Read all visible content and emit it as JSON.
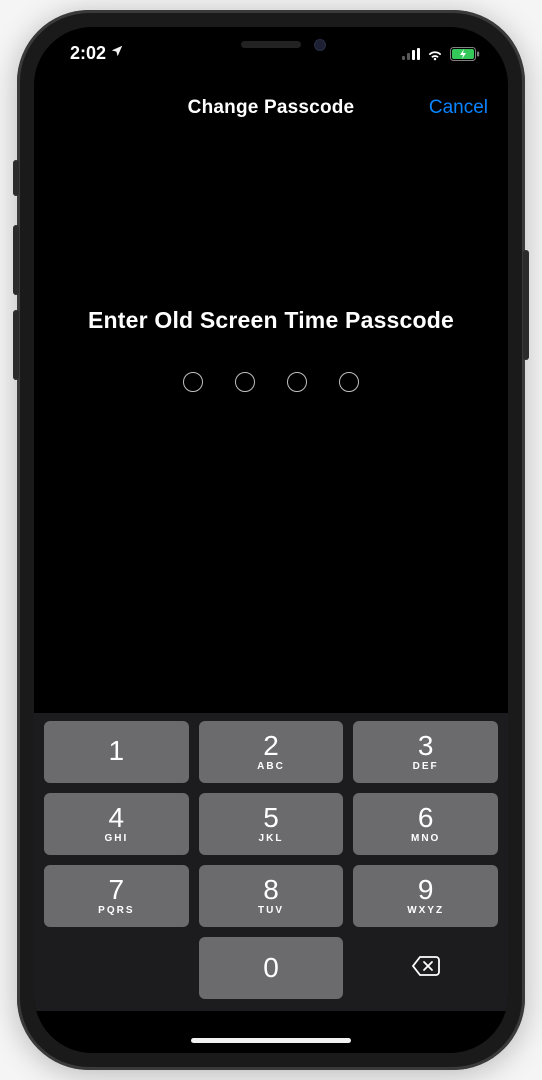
{
  "status": {
    "time": "2:02",
    "locationIcon": "location-arrow-icon"
  },
  "nav": {
    "title": "Change Passcode",
    "cancel": "Cancel"
  },
  "prompt": {
    "text": "Enter Old Screen Time Passcode",
    "passcodeLength": 4
  },
  "keypad": {
    "keys": [
      {
        "digit": "1",
        "letters": ""
      },
      {
        "digit": "2",
        "letters": "ABC"
      },
      {
        "digit": "3",
        "letters": "DEF"
      },
      {
        "digit": "4",
        "letters": "GHI"
      },
      {
        "digit": "5",
        "letters": "JKL"
      },
      {
        "digit": "6",
        "letters": "MNO"
      },
      {
        "digit": "7",
        "letters": "PQRS"
      },
      {
        "digit": "8",
        "letters": "TUV"
      },
      {
        "digit": "9",
        "letters": "WXYZ"
      },
      {
        "digit": "0",
        "letters": ""
      }
    ],
    "deleteIcon": "delete-icon"
  },
  "colors": {
    "accent": "#0a84ff",
    "keyBg": "#6b6b6d",
    "keypadBg": "#1c1c1e"
  }
}
